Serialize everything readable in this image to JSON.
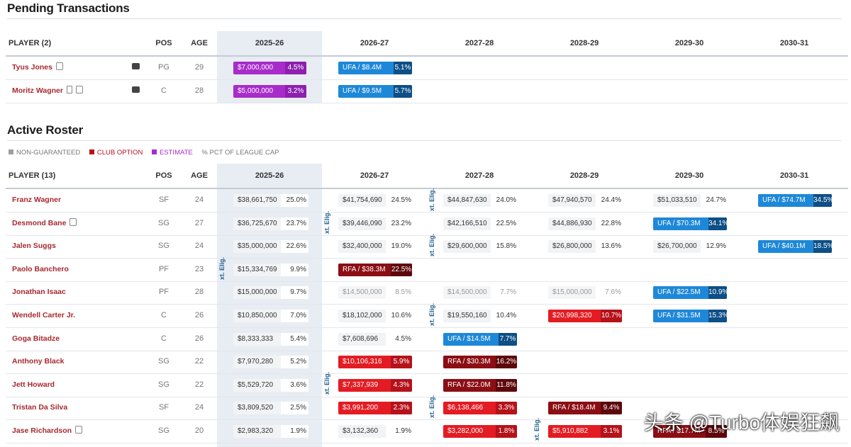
{
  "pending": {
    "title": "Pending Transactions",
    "headers": {
      "player": "PLAYER (2)",
      "pos": "POS",
      "age": "AGE",
      "years": [
        "2025-26",
        "2026-27",
        "2027-28",
        "2028-29",
        "2029-30",
        "2030-31"
      ]
    },
    "rows": [
      {
        "name": "Tyus Jones",
        "pos": "PG",
        "age": "29",
        "c25": {
          "v": "$7,000,000",
          "p": "4.5%"
        },
        "c26": {
          "v": "UFA / $8.4M",
          "p": "5.1%"
        }
      },
      {
        "name": "Moritz Wagner",
        "pos": "C",
        "age": "28",
        "c25": {
          "v": "$5,000,000",
          "p": "3.2%"
        },
        "c26": {
          "v": "UFA / $9.5M",
          "p": "5.7%"
        }
      }
    ]
  },
  "active": {
    "title": "Active Roster",
    "legend": {
      "non_guaranteed": "NON-GUARANTEED",
      "club_option": "CLUB OPTION",
      "estimate": "ESTIMATE",
      "pct": "% PCT OF LEAGUE CAP"
    },
    "colors": {
      "non_guaranteed": "#9e9e9e",
      "club_option": "#b5121a",
      "estimate": "#a72cc9"
    },
    "elig_label": "xt. Elig.",
    "headers": {
      "player": "PLAYER (13)",
      "pos": "POS",
      "age": "AGE",
      "years": [
        "2025-26",
        "2026-27",
        "2027-28",
        "2028-29",
        "2029-30",
        "2030-31"
      ]
    },
    "rows": [
      {
        "name": "Franz Wagner",
        "pos": "SF",
        "age": "24",
        "cells": [
          {
            "t": "plain",
            "v": "$38,661,750",
            "p": "25.0%"
          },
          {
            "t": "plain",
            "v": "$41,754,690",
            "p": "24.5%"
          },
          {
            "t": "plain",
            "v": "$44,847,630",
            "p": "24.0%"
          },
          {
            "t": "plain",
            "v": "$47,940,570",
            "p": "24.4%"
          },
          {
            "t": "plain",
            "v": "$51,033,510",
            "p": "24.7%"
          },
          {
            "t": "ufa",
            "v": "UFA / $74.7M",
            "p": "34.5%"
          }
        ]
      },
      {
        "name": "Desmond Bane",
        "pos": "SG",
        "age": "27",
        "cells": [
          {
            "t": "plain",
            "v": "$36,725,670",
            "p": "23.7%"
          },
          {
            "t": "plain",
            "v": "$39,446,090",
            "p": "23.2%"
          },
          {
            "t": "plain",
            "v": "$42,166,510",
            "p": "22.5%"
          },
          {
            "t": "plain",
            "v": "$44,886,930",
            "p": "22.8%"
          },
          {
            "t": "ufa",
            "v": "UFA / $70.3M",
            "p": "34.1%"
          },
          null
        ]
      },
      {
        "name": "Jalen Suggs",
        "pos": "SG",
        "age": "24",
        "cells": [
          {
            "t": "plain",
            "v": "$35,000,000",
            "p": "22.6%"
          },
          {
            "t": "plain",
            "v": "$32,400,000",
            "p": "19.0%"
          },
          {
            "t": "plain",
            "v": "$29,600,000",
            "p": "15.8%"
          },
          {
            "t": "plain",
            "v": "$26,800,000",
            "p": "13.6%"
          },
          {
            "t": "plain",
            "v": "$26,700,000",
            "p": "12.9%"
          },
          {
            "t": "ufa",
            "v": "UFA / $40.1M",
            "p": "18.5%"
          }
        ]
      },
      {
        "name": "Paolo Banchero",
        "pos": "PF",
        "age": "23",
        "cells": [
          {
            "t": "plain",
            "v": "$15,334,769",
            "p": "9.9%"
          },
          {
            "t": "rfa",
            "v": "RFA / $38.3M",
            "p": "22.5%"
          },
          null,
          null,
          null,
          null
        ]
      },
      {
        "name": "Jonathan Isaac",
        "pos": "PF",
        "age": "28",
        "cells": [
          {
            "t": "plain",
            "v": "$15,000,000",
            "p": "9.7%"
          },
          {
            "t": "grey",
            "v": "$14,500,000",
            "p": "8.5%"
          },
          {
            "t": "grey",
            "v": "$14,500,000",
            "p": "7.7%"
          },
          {
            "t": "grey",
            "v": "$15,000,000",
            "p": "7.6%"
          },
          {
            "t": "ufa",
            "v": "UFA / $22.5M",
            "p": "10.9%"
          },
          null
        ]
      },
      {
        "name": "Wendell Carter Jr.",
        "pos": "C",
        "age": "26",
        "cells": [
          {
            "t": "plain",
            "v": "$10,850,000",
            "p": "7.0%"
          },
          {
            "t": "plain",
            "v": "$18,102,000",
            "p": "10.6%"
          },
          {
            "t": "plain",
            "v": "$19,550,160",
            "p": "10.4%"
          },
          {
            "t": "red",
            "v": "$20,998,320",
            "p": "10.7%"
          },
          {
            "t": "ufa",
            "v": "UFA / $31.5M",
            "p": "15.3%"
          },
          null
        ]
      },
      {
        "name": "Goga Bitadze",
        "pos": "C",
        "age": "26",
        "cells": [
          {
            "t": "plain",
            "v": "$8,333,333",
            "p": "5.4%"
          },
          {
            "t": "plain",
            "v": "$7,608,696",
            "p": "4.5%"
          },
          {
            "t": "ufa",
            "v": "UFA / $14.5M",
            "p": "7.7%"
          },
          null,
          null,
          null
        ]
      },
      {
        "name": "Anthony Black",
        "pos": "SG",
        "age": "22",
        "cells": [
          {
            "t": "plain",
            "v": "$7,970,280",
            "p": "5.2%"
          },
          {
            "t": "red",
            "v": "$10,106,316",
            "p": "5.9%"
          },
          {
            "t": "rfa",
            "v": "RFA / $30.3M",
            "p": "16.2%"
          },
          null,
          null,
          null
        ]
      },
      {
        "name": "Jett Howard",
        "pos": "SG",
        "age": "22",
        "cells": [
          {
            "t": "plain",
            "v": "$5,529,720",
            "p": "3.6%"
          },
          {
            "t": "red",
            "v": "$7,337,939",
            "p": "4.3%"
          },
          {
            "t": "rfa",
            "v": "RFA / $22.0M",
            "p": "11.8%"
          },
          null,
          null,
          null
        ]
      },
      {
        "name": "Tristan Da Silva",
        "pos": "SF",
        "age": "24",
        "cells": [
          {
            "t": "plain",
            "v": "$3,809,520",
            "p": "2.5%"
          },
          {
            "t": "red",
            "v": "$3,991,200",
            "p": "2.3%"
          },
          {
            "t": "red",
            "v": "$6,138,466",
            "p": "3.3%"
          },
          {
            "t": "rfa",
            "v": "RFA / $18.4M",
            "p": "9.4%"
          },
          null,
          null
        ]
      },
      {
        "name": "Jase Richardson",
        "pos": "SG",
        "age": "20",
        "cells": [
          {
            "t": "plain",
            "v": "$2,983,320",
            "p": "1.9%"
          },
          {
            "t": "plain",
            "v": "$3,132,360",
            "p": "1.9%"
          },
          {
            "t": "red",
            "v": "$3,282,000",
            "p": "1.8%"
          },
          {
            "t": "red",
            "v": "$5,910,882",
            "p": "3.1%"
          },
          {
            "t": "rfa",
            "v": "RFA / $17.7M",
            "p": "8.5%"
          },
          null
        ]
      }
    ]
  },
  "watermark": "头条 @Turbo体娱狂飙"
}
